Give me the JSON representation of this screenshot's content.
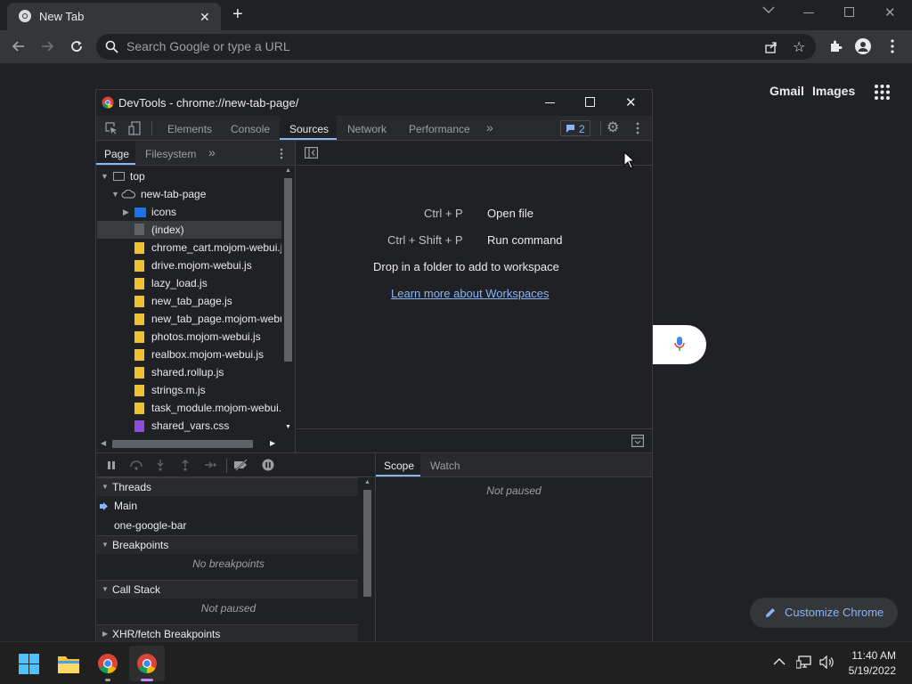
{
  "browser": {
    "tab_title": "New Tab",
    "omnibox_placeholder": "Search Google or type a URL"
  },
  "ntp": {
    "gmail": "Gmail",
    "images": "Images",
    "customize": "Customize Chrome"
  },
  "devtools": {
    "title": "DevTools - chrome://new-tab-page/",
    "tabs": [
      "Elements",
      "Console",
      "Sources",
      "Network",
      "Performance"
    ],
    "active_tab": "Sources",
    "issues_count": "2",
    "nav_tabs": [
      "Page",
      "Filesystem"
    ],
    "tree": {
      "top": "top",
      "origin": "new-tab-page",
      "folder": "icons",
      "files": [
        {
          "name": "(index)",
          "type": "doc"
        },
        {
          "name": "chrome_cart.mojom-webui.j",
          "type": "js"
        },
        {
          "name": "drive.mojom-webui.js",
          "type": "js"
        },
        {
          "name": "lazy_load.js",
          "type": "js"
        },
        {
          "name": "new_tab_page.js",
          "type": "js"
        },
        {
          "name": "new_tab_page.mojom-webu",
          "type": "js"
        },
        {
          "name": "photos.mojom-webui.js",
          "type": "js"
        },
        {
          "name": "realbox.mojom-webui.js",
          "type": "js"
        },
        {
          "name": "shared.rollup.js",
          "type": "js"
        },
        {
          "name": "strings.m.js",
          "type": "js"
        },
        {
          "name": "task_module.mojom-webui.",
          "type": "js"
        },
        {
          "name": "shared_vars.css",
          "type": "css"
        }
      ]
    },
    "editor": {
      "shortcut1_key": "Ctrl + P",
      "shortcut1_label": "Open file",
      "shortcut2_key": "Ctrl + Shift + P",
      "shortcut2_label": "Run command",
      "drop_text": "Drop in a folder to add to workspace",
      "learn_more": "Learn more about Workspaces"
    },
    "debugger": {
      "threads_label": "Threads",
      "threads": [
        "Main",
        "one-google-bar"
      ],
      "breakpoints_label": "Breakpoints",
      "no_breakpoints": "No breakpoints",
      "callstack_label": "Call Stack",
      "not_paused": "Not paused",
      "xhr_label": "XHR/fetch Breakpoints",
      "scope_tab": "Scope",
      "watch_tab": "Watch",
      "scope_status": "Not paused"
    },
    "colors": {
      "accent": "#8ab4f8",
      "js_file": "#f0c030",
      "css_file": "#8a4fd8",
      "folder": "#1a73e8"
    }
  },
  "taskbar": {
    "time": "11:40 AM",
    "date": "5/19/2022"
  }
}
